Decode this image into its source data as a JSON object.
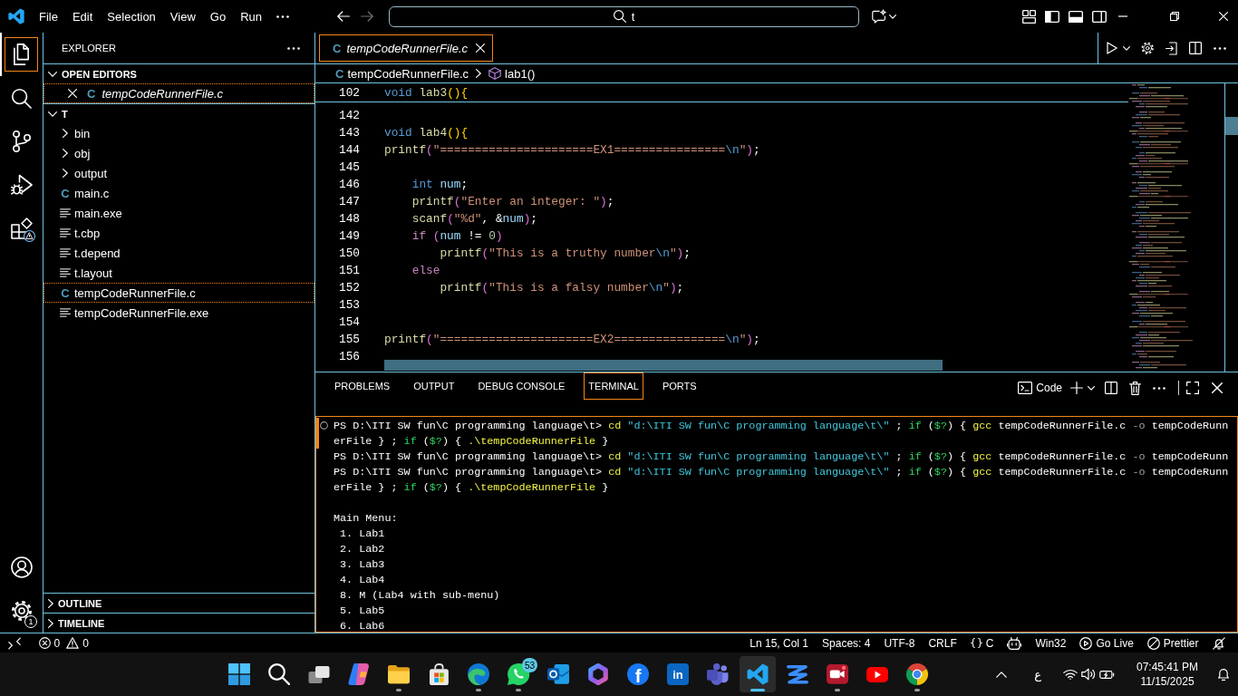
{
  "title_bar": {
    "menu": [
      "File",
      "Edit",
      "Selection",
      "View",
      "Go",
      "Run"
    ],
    "navigation": {
      "back_disabled": false,
      "forward_disabled": true
    },
    "command_center": "t"
  },
  "activity_bar": {
    "items": [
      {
        "kind": "explorer",
        "selected": true,
        "warning": false
      },
      {
        "kind": "search",
        "selected": false,
        "warning": false
      },
      {
        "kind": "source_control",
        "selected": false,
        "warning": false
      },
      {
        "kind": "run_debug",
        "selected": false,
        "warning": false
      },
      {
        "kind": "extensions",
        "selected": false,
        "warning": true
      }
    ],
    "manage_badge": "1"
  },
  "sidebar": {
    "title": "EXPLORER",
    "open_editors": {
      "label": "OPEN EDITORS",
      "expanded": true,
      "items": [
        {
          "name": "tempCodeRunnerFile.c",
          "glyph": "C",
          "preview": true,
          "selected": true
        }
      ]
    },
    "folder": {
      "label": "T",
      "expanded": true,
      "children": [
        {
          "name": "bin",
          "kind": "folder",
          "expanded": false,
          "selected": false
        },
        {
          "name": "obj",
          "kind": "folder",
          "expanded": false,
          "selected": false
        },
        {
          "name": "output",
          "kind": "folder",
          "expanded": false,
          "selected": false
        },
        {
          "name": "main.c",
          "kind": "file",
          "glyph": "C",
          "selected": false
        },
        {
          "name": "main.exe",
          "kind": "file",
          "selected": false
        },
        {
          "name": "t.cbp",
          "kind": "file",
          "selected": false
        },
        {
          "name": "t.depend",
          "kind": "file",
          "selected": false
        },
        {
          "name": "t.layout",
          "kind": "file",
          "selected": false
        },
        {
          "name": "tempCodeRunnerFile.c",
          "kind": "file",
          "glyph": "C",
          "selected": true
        },
        {
          "name": "tempCodeRunnerFile.exe",
          "kind": "file",
          "selected": false
        }
      ]
    },
    "sections": [
      {
        "label": "OUTLINE",
        "expanded": false
      },
      {
        "label": "TIMELINE",
        "expanded": false
      }
    ]
  },
  "editor": {
    "tabs": [
      {
        "name": "tempCodeRunnerFile.c",
        "glyph": "C",
        "preview": true,
        "selected": true
      }
    ],
    "breadcrumb": {
      "glyph": "C",
      "file": "tempCodeRunnerFile.c",
      "symbol": "lab1()"
    },
    "sticky_line": {
      "number": "102",
      "tokens": [
        {
          "text": "void",
          "kind": "keyword"
        },
        {
          "text": " lab3",
          "kind": "function"
        },
        {
          "text": "(){",
          "kind": "bracket1"
        }
      ]
    },
    "lines": [
      {
        "number": "142"
      },
      {
        "number": "143",
        "tokens": [
          {
            "text": "void",
            "kind": "keyword"
          },
          {
            "text": " lab4",
            "kind": "function"
          },
          {
            "text": "(){",
            "kind": "bracket1"
          }
        ]
      },
      {
        "number": "144",
        "tokens": [
          {
            "text": "printf",
            "kind": "function"
          },
          {
            "text": "(",
            "kind": "bracket2"
          },
          {
            "text": "\"======================EX1================",
            "kind": "string"
          },
          {
            "text": "\\n",
            "kind": "escape"
          },
          {
            "text": "\"",
            "kind": "string"
          },
          {
            "text": ")",
            "kind": "bracket2"
          },
          {
            "text": ";",
            "kind": "plain"
          }
        ]
      },
      {
        "number": "145"
      },
      {
        "number": "146",
        "tokens": [
          {
            "text": "    int",
            "kind": "keyword"
          },
          {
            "text": " num",
            "kind": "variable"
          },
          {
            "text": ";",
            "kind": "plain"
          }
        ]
      },
      {
        "number": "147",
        "tokens": [
          {
            "text": "    printf",
            "kind": "function"
          },
          {
            "text": "(",
            "kind": "bracket2"
          },
          {
            "text": "\"Enter an integer: \"",
            "kind": "string"
          },
          {
            "text": ")",
            "kind": "bracket2"
          },
          {
            "text": ";",
            "kind": "plain"
          }
        ]
      },
      {
        "number": "148",
        "tokens": [
          {
            "text": "    scanf",
            "kind": "function"
          },
          {
            "text": "(",
            "kind": "bracket2"
          },
          {
            "text": "\"%d\"",
            "kind": "string"
          },
          {
            "text": ", &",
            "kind": "plain"
          },
          {
            "text": "num",
            "kind": "variable"
          },
          {
            "text": ")",
            "kind": "bracket2"
          },
          {
            "text": ";",
            "kind": "plain"
          }
        ]
      },
      {
        "number": "149",
        "tokens": [
          {
            "text": "    if",
            "kind": "control"
          },
          {
            "text": " (",
            "kind": "bracket2"
          },
          {
            "text": "num",
            "kind": "variable"
          },
          {
            "text": " != ",
            "kind": "plain"
          },
          {
            "text": "0",
            "kind": "number"
          },
          {
            "text": ")",
            "kind": "bracket2"
          }
        ]
      },
      {
        "number": "150",
        "tokens": [
          {
            "text": "        printf",
            "kind": "function"
          },
          {
            "text": "(",
            "kind": "bracket2"
          },
          {
            "text": "\"This is a truthy number",
            "kind": "string"
          },
          {
            "text": "\\n",
            "kind": "escape"
          },
          {
            "text": "\"",
            "kind": "string"
          },
          {
            "text": ")",
            "kind": "bracket2"
          },
          {
            "text": ";",
            "kind": "plain"
          }
        ]
      },
      {
        "number": "151",
        "tokens": [
          {
            "text": "    else",
            "kind": "control"
          }
        ]
      },
      {
        "number": "152",
        "tokens": [
          {
            "text": "        printf",
            "kind": "function"
          },
          {
            "text": "(",
            "kind": "bracket2"
          },
          {
            "text": "\"This is a falsy number",
            "kind": "string"
          },
          {
            "text": "\\n",
            "kind": "escape"
          },
          {
            "text": "\"",
            "kind": "string"
          },
          {
            "text": ")",
            "kind": "bracket2"
          },
          {
            "text": ";",
            "kind": "plain"
          }
        ]
      },
      {
        "number": "153"
      },
      {
        "number": "154"
      },
      {
        "number": "155",
        "tokens": [
          {
            "text": "printf",
            "kind": "function"
          },
          {
            "text": "(",
            "kind": "bracket2"
          },
          {
            "text": "\"======================EX2================",
            "kind": "string"
          },
          {
            "text": "\\n",
            "kind": "escape"
          },
          {
            "text": "\"",
            "kind": "string"
          },
          {
            "text": ")",
            "kind": "bracket2"
          },
          {
            "text": ";",
            "kind": "plain"
          }
        ]
      },
      {
        "number": "156"
      }
    ],
    "selection_below": true
  },
  "panel": {
    "tabs": [
      {
        "label": "PROBLEMS",
        "selected": false
      },
      {
        "label": "OUTPUT",
        "selected": false
      },
      {
        "label": "DEBUG CONSOLE",
        "selected": false
      },
      {
        "label": "TERMINAL",
        "selected": true
      },
      {
        "label": "PORTS",
        "selected": false
      }
    ],
    "terminal": {
      "name": "Code",
      "focused": true,
      "lines": [
        {
          "marker": true,
          "highlighted": true,
          "tokens": [
            {
              "text": "PS D:\\ITI SW fun\\C programming language\\t> ",
              "kind": "plain"
            },
            {
              "text": "cd",
              "kind": "command"
            },
            {
              "text": " \"d:\\ITI SW fun\\C programming language\\t\\\"",
              "kind": "string"
            },
            {
              "text": " ; ",
              "kind": "plain"
            },
            {
              "text": "if",
              "kind": "keyword"
            },
            {
              "text": " (",
              "kind": "plain"
            },
            {
              "text": "$?",
              "kind": "keyword"
            },
            {
              "text": ") { ",
              "kind": "plain"
            },
            {
              "text": "gcc",
              "kind": "command"
            },
            {
              "text": " tempCodeRunnerFile.c ",
              "kind": "plain"
            },
            {
              "text": "-o",
              "kind": "param"
            },
            {
              "text": " tempCodeRunn",
              "kind": "plain"
            }
          ]
        },
        {
          "marker": false,
          "highlighted": true,
          "tokens": [
            {
              "text": "erFile } ; ",
              "kind": "plain"
            },
            {
              "text": "if",
              "kind": "keyword"
            },
            {
              "text": " (",
              "kind": "plain"
            },
            {
              "text": "$?",
              "kind": "keyword"
            },
            {
              "text": ") { ",
              "kind": "plain"
            },
            {
              "text": ".\\tempCodeRunnerFile",
              "kind": "command"
            },
            {
              "text": " }",
              "kind": "plain"
            }
          ]
        },
        {
          "marker": false,
          "highlighted": false,
          "tokens": [
            {
              "text": "PS D:\\ITI SW fun\\C programming language\\t> ",
              "kind": "plain"
            },
            {
              "text": "cd",
              "kind": "command"
            },
            {
              "text": " \"d:\\ITI SW fun\\C programming language\\t\\\"",
              "kind": "string"
            },
            {
              "text": " ; ",
              "kind": "plain"
            },
            {
              "text": "if",
              "kind": "keyword"
            },
            {
              "text": " (",
              "kind": "plain"
            },
            {
              "text": "$?",
              "kind": "keyword"
            },
            {
              "text": ") { ",
              "kind": "plain"
            },
            {
              "text": "gcc",
              "kind": "command"
            },
            {
              "text": " tempCodeRunnerFile.c ",
              "kind": "plain"
            },
            {
              "text": "-o",
              "kind": "param"
            },
            {
              "text": " tempCodeRunn",
              "kind": "plain"
            }
          ]
        },
        {
          "marker": false,
          "highlighted": false,
          "tokens": [
            {
              "text": "PS D:\\ITI SW fun\\C programming language\\t> ",
              "kind": "plain"
            },
            {
              "text": "cd",
              "kind": "command"
            },
            {
              "text": " \"d:\\ITI SW fun\\C programming language\\t\\\"",
              "kind": "string"
            },
            {
              "text": " ; ",
              "kind": "plain"
            },
            {
              "text": "if",
              "kind": "keyword"
            },
            {
              "text": " (",
              "kind": "plain"
            },
            {
              "text": "$?",
              "kind": "keyword"
            },
            {
              "text": ") { ",
              "kind": "plain"
            },
            {
              "text": "gcc",
              "kind": "command"
            },
            {
              "text": " tempCodeRunnerFile.c ",
              "kind": "plain"
            },
            {
              "text": "-o",
              "kind": "param"
            },
            {
              "text": " tempCodeRunn",
              "kind": "plain"
            }
          ]
        },
        {
          "marker": false,
          "highlighted": false,
          "tokens": [
            {
              "text": "erFile } ; ",
              "kind": "plain"
            },
            {
              "text": "if",
              "kind": "keyword"
            },
            {
              "text": " (",
              "kind": "plain"
            },
            {
              "text": "$?",
              "kind": "keyword"
            },
            {
              "text": ") { ",
              "kind": "plain"
            },
            {
              "text": ".\\tempCodeRunnerFile",
              "kind": "command"
            },
            {
              "text": " }",
              "kind": "plain"
            }
          ]
        },
        {
          "marker": false,
          "highlighted": false
        },
        {
          "marker": false,
          "highlighted": false,
          "text": "Main Menu:"
        },
        {
          "marker": false,
          "highlighted": false,
          "text": " 1. Lab1"
        },
        {
          "marker": false,
          "highlighted": false,
          "text": " 2. Lab2"
        },
        {
          "marker": false,
          "highlighted": false,
          "text": " 3. Lab3"
        },
        {
          "marker": false,
          "highlighted": false,
          "text": " 4. Lab4"
        },
        {
          "marker": false,
          "highlighted": false,
          "text": " 8. M (Lab4 with sub-menu)"
        },
        {
          "marker": false,
          "highlighted": false,
          "text": " 5. Lab5"
        },
        {
          "marker": false,
          "highlighted": false,
          "text": " 6. Lab6"
        }
      ]
    }
  },
  "status_bar": {
    "problems": {
      "errors": "0",
      "warnings": "0"
    },
    "items": [
      {
        "kind": "text",
        "text": "Ln 15, Col 1"
      },
      {
        "kind": "text",
        "text": "Spaces: 4"
      },
      {
        "kind": "text",
        "text": "UTF-8"
      },
      {
        "kind": "text",
        "text": "CRLF"
      },
      {
        "kind": "language",
        "text": "C"
      },
      {
        "kind": "assistant"
      },
      {
        "kind": "text",
        "text": "Win32"
      },
      {
        "kind": "live",
        "text": "Go Live"
      },
      {
        "kind": "formatter",
        "text": "Prettier"
      },
      {
        "kind": "notifications"
      }
    ]
  },
  "taskbar": {
    "apps": [
      {
        "kind": "start",
        "running": false,
        "selected": false
      },
      {
        "kind": "search",
        "running": false,
        "selected": false
      },
      {
        "kind": "task_view",
        "running": false,
        "selected": false
      },
      {
        "kind": "copilot",
        "running": false,
        "selected": false
      },
      {
        "kind": "files",
        "running": true,
        "selected": false
      },
      {
        "kind": "store",
        "running": false,
        "selected": false
      },
      {
        "kind": "edge",
        "running": true,
        "selected": false
      },
      {
        "kind": "whatsapp",
        "badge": "53",
        "running": true,
        "selected": false
      },
      {
        "kind": "outlook",
        "running": false,
        "selected": false
      },
      {
        "kind": "hexagon",
        "running": false,
        "selected": false
      },
      {
        "kind": "facebook",
        "glyph": "f",
        "running": false,
        "selected": false
      },
      {
        "kind": "linkedin",
        "glyph": "in",
        "running": false,
        "selected": false
      },
      {
        "kind": "teams",
        "running": false,
        "selected": false
      },
      {
        "kind": "vscode",
        "running": true,
        "selected": true
      },
      {
        "kind": "zigzag",
        "running": false,
        "selected": false
      },
      {
        "kind": "recorder",
        "running": true,
        "selected": false
      },
      {
        "kind": "youtube",
        "running": false,
        "selected": false
      },
      {
        "kind": "chrome",
        "running": true,
        "selected": false
      }
    ],
    "tray": {
      "input_language": "ع",
      "time": "07:45:41 PM",
      "date": "11/15/2025"
    }
  }
}
